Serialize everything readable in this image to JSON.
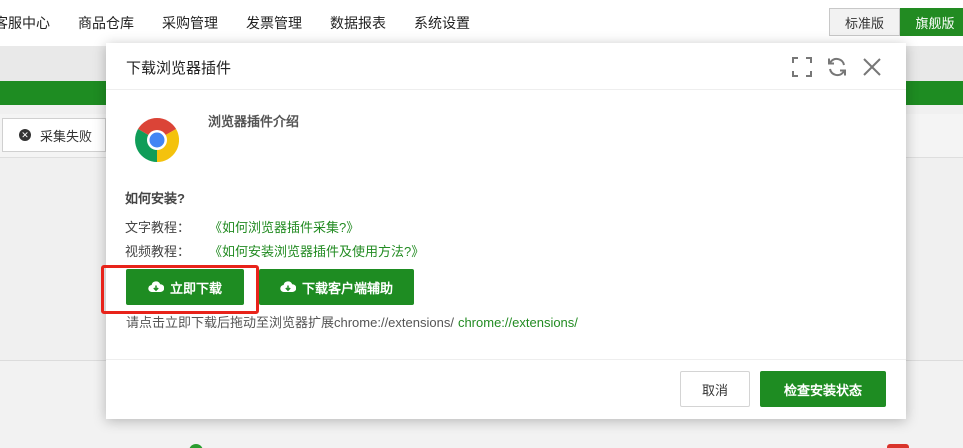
{
  "topnav": {
    "items": [
      "客服中心",
      "商品仓库",
      "采购管理",
      "发票管理",
      "数据报表",
      "系统设置"
    ],
    "version_standard": "标准版",
    "version_flagship": "旗舰版"
  },
  "background": {
    "fail_tab_label": "采集失败"
  },
  "modal": {
    "title": "下载浏览器插件",
    "icons": [
      "fullscreen-icon",
      "refresh-icon",
      "close-icon"
    ],
    "intro_title": "浏览器插件介绍",
    "how_title": "如何安装?",
    "text_tutorial_label": "文字教程：",
    "text_tutorial_link": "《如何浏览器插件采集?》",
    "video_tutorial_label": "视频教程：",
    "video_tutorial_link": "《如何安装浏览器插件及使用方法?》",
    "download_now": "立即下载",
    "download_client": "下载客户端辅助",
    "hint_text": "请点击立即下载后拖动至浏览器扩展chrome://extensions/",
    "hint_link": "chrome://extensions/",
    "cancel": "取消",
    "check_status": "检查安装状态"
  },
  "colors": {
    "brand_green": "#1e8c22",
    "link_green": "#228b22",
    "highlight_red": "#e8231a"
  }
}
